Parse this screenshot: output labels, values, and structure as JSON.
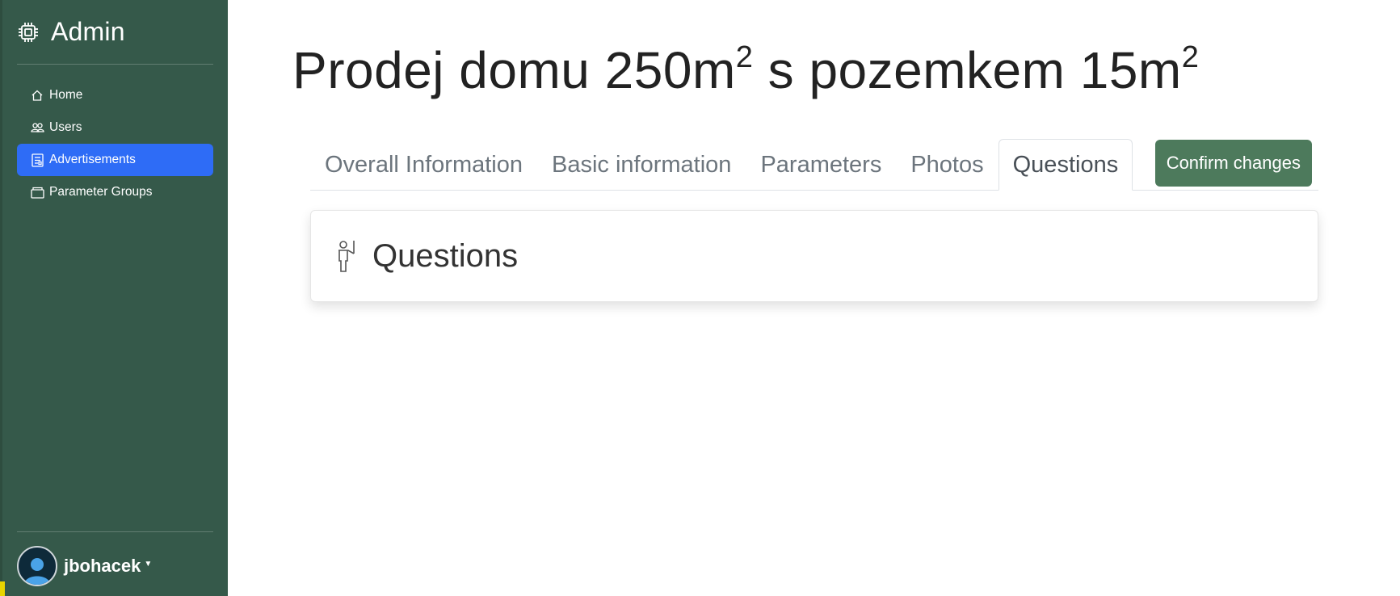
{
  "sidebar": {
    "brand": {
      "title": "Admin",
      "icon": "cpu-icon"
    },
    "items": [
      {
        "label": "Home",
        "icon": "house-icon",
        "active": false
      },
      {
        "label": "Users",
        "icon": "people-icon",
        "active": false
      },
      {
        "label": "Advertisements",
        "icon": "list-icon",
        "active": true
      },
      {
        "label": "Parameter Groups",
        "icon": "box-icon",
        "active": false
      }
    ],
    "user": {
      "name": "jbohacek",
      "avatar": "user-avatar-icon"
    }
  },
  "main": {
    "title_part1": "Prodej domu 250m",
    "title_sup1": "2",
    "title_part2": " s pozemkem 15m",
    "title_sup2": "2",
    "tabs": [
      {
        "label": "Overall Information",
        "active": false
      },
      {
        "label": "Basic information",
        "active": false
      },
      {
        "label": "Parameters",
        "active": false
      },
      {
        "label": "Photos",
        "active": false
      },
      {
        "label": "Questions",
        "active": true
      }
    ],
    "confirm_label": "Confirm changes",
    "card": {
      "title": "Questions",
      "icon": "person-raised-hand-icon"
    }
  },
  "colors": {
    "sidebar_bg": "#35594a",
    "active_nav": "#2e6cf6",
    "confirm_button": "#4d7a5c"
  }
}
